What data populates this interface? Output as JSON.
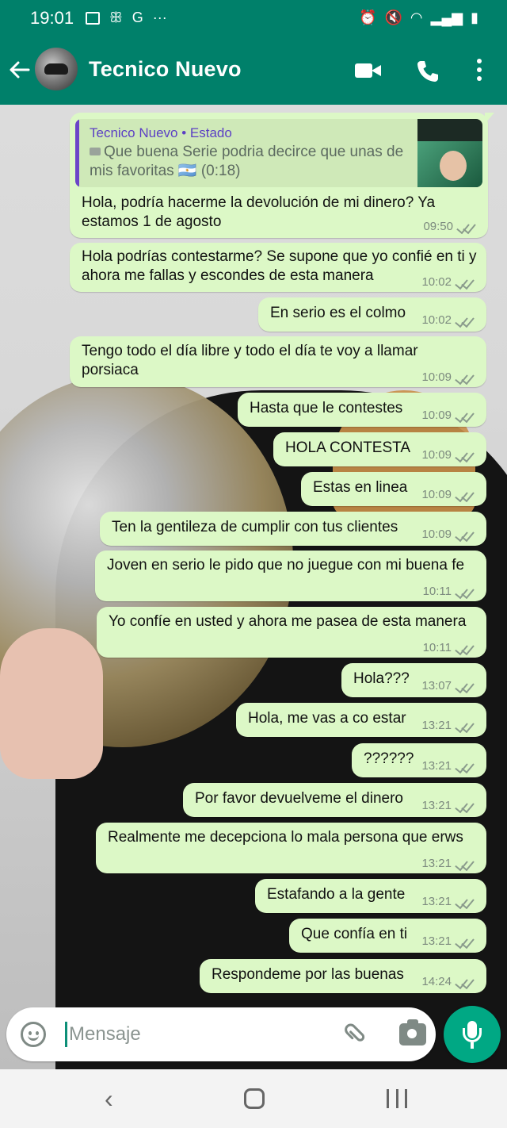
{
  "status_bar": {
    "time": "19:01",
    "left_icons": [
      "image-icon",
      "fingerprint-icon",
      "google-icon",
      "more-icon"
    ],
    "google_letter": "G",
    "more_dots": "···",
    "right_icons": [
      "alarm-icon",
      "mute-icon",
      "wifi-icon",
      "signal-icon",
      "battery-charging-icon"
    ]
  },
  "header": {
    "contact_name": "Tecnico Nuevo",
    "back_icon": "arrow-left-icon",
    "video_icon": "video-call-icon",
    "call_icon": "phone-icon",
    "menu_icon": "more-vertical-icon"
  },
  "quote": {
    "author": "Tecnico Nuevo • Estado",
    "text": "Que buena Serie podria decirce que unas de mis favoritas 🇦🇷 (0:18)"
  },
  "messages": [
    {
      "text": "Hola, podría hacerme la devolución de mi dinero? Ya estamos 1 de agosto",
      "time": "09:50"
    },
    {
      "text": "Hola podrías contestarme? Se supone que yo confié en ti y ahora me fallas y escondes de esta manera",
      "time": "10:02"
    },
    {
      "text": "En serio es el colmo",
      "time": "10:02"
    },
    {
      "text": "Tengo todo el día libre y todo el día te voy a llamar porsiaca",
      "time": "10:09"
    },
    {
      "text": "Hasta que le contestes",
      "time": "10:09"
    },
    {
      "text": "HOLA CONTESTA",
      "time": "10:09"
    },
    {
      "text": "Estas en linea",
      "time": "10:09"
    },
    {
      "text": "Ten la gentileza de cumplir con tus clientes",
      "time": "10:09"
    },
    {
      "text": "Joven en serio le pido que no juegue con mi buena fe",
      "time": "10:11"
    },
    {
      "text": "Yo confíe en usted y ahora me pasea de esta manera",
      "time": "10:11"
    },
    {
      "text": "Hola???",
      "time": "13:07"
    },
    {
      "text": "Hola, me vas a co estar",
      "time": "13:21"
    },
    {
      "text": "??????",
      "time": "13:21"
    },
    {
      "text": "Por favor devuelveme el dinero",
      "time": "13:21"
    },
    {
      "text": "Realmente me decepciona lo mala persona que erws",
      "time": "13:21"
    },
    {
      "text": "Estafando a la gente",
      "time": "13:21"
    },
    {
      "text": "Que confía en ti",
      "time": "13:21"
    },
    {
      "text": "Respondeme por las buenas",
      "time": "14:24"
    }
  ],
  "input": {
    "placeholder": "Mensaje",
    "emoji_icon": "emoji-icon",
    "attach_icon": "paperclip-icon",
    "camera_icon": "camera-icon",
    "mic_icon": "microphone-icon"
  },
  "nav": {
    "back_glyph": "‹",
    "icons": [
      "nav-back-icon",
      "nav-home-icon",
      "nav-recents-icon"
    ]
  },
  "colors": {
    "header_green": "#00806a",
    "bubble_green": "#dcf8c6",
    "mic_green": "#00a884",
    "quote_author_purple": "#5b3fc4"
  }
}
